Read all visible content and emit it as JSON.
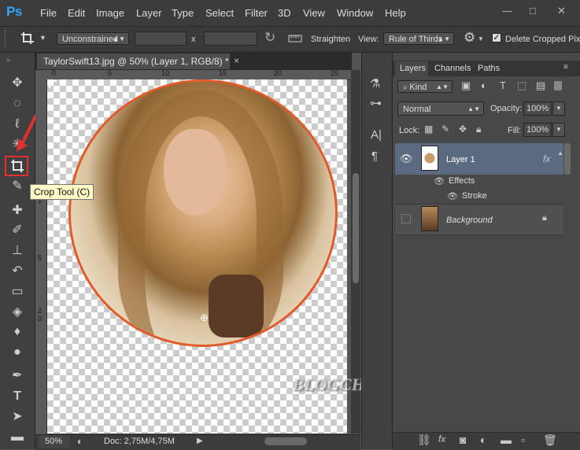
{
  "app": {
    "logo": "Ps"
  },
  "menu": [
    "File",
    "Edit",
    "Image",
    "Layer",
    "Type",
    "Select",
    "Filter",
    "3D",
    "View",
    "Window",
    "Help"
  ],
  "window_controls": {
    "minimize": "—",
    "maximize": "□",
    "close": "✕"
  },
  "options": {
    "ratio": "Unconstrained",
    "x_sep": "x",
    "straighten": "Straighten",
    "view_label": "View:",
    "view_value": "Rule of Thirds",
    "delete_cropped": "Delete Cropped Pixe"
  },
  "document": {
    "tab_title": "TaylorSwift13.jpg @ 50% (Layer 1, RGB/8) *",
    "close": "×",
    "ruler_top": [
      "0",
      "5",
      "10",
      "15",
      "20",
      "25"
    ],
    "ruler_left": [
      "1",
      "5",
      "2",
      "0"
    ],
    "zoom": "50%",
    "doc_info": "Doc: 2,75M/4,75M"
  },
  "tooltip": "Crop Tool (C)",
  "layers_panel": {
    "tabs": [
      "Layers",
      "Channels",
      "Paths"
    ],
    "kind": "Kind",
    "blend_mode": "Normal",
    "opacity_label": "Opacity:",
    "opacity": "100%",
    "lock_label": "Lock:",
    "fill_label": "Fill:",
    "fill": "100%",
    "layers": [
      {
        "name": "Layer 1",
        "fx": "fx",
        "effects": "Effects",
        "stroke": "Stroke"
      },
      {
        "name": "Background"
      }
    ]
  },
  "watermark": "BLOGCHIASEKIENTHUC.COM",
  "colors": {
    "stroke": "#e05a2a",
    "highlight": "#e03030",
    "selected_layer": "#5b6a80"
  }
}
